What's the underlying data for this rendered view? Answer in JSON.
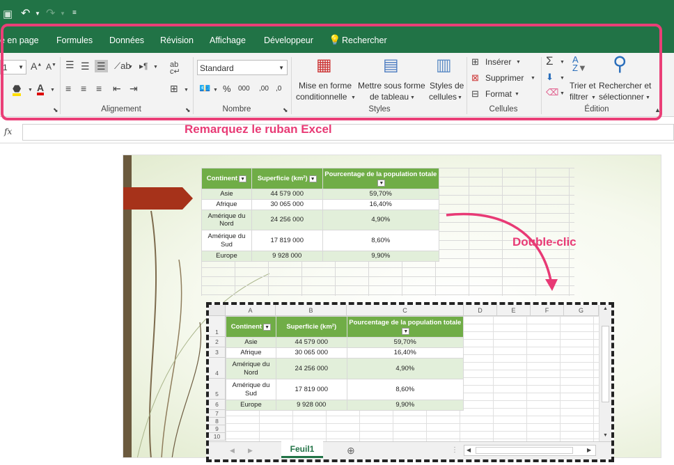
{
  "tabs": [
    "e en page",
    "Formules",
    "Données",
    "Révision",
    "Affichage",
    "Développeur",
    "Rechercher"
  ],
  "font_size_value": "1",
  "number_format": "Standard",
  "ribbon": {
    "conditional_format": [
      "Mise en forme",
      "conditionnelle"
    ],
    "table_format": [
      "Mettre sous forme",
      "de tableau"
    ],
    "cell_styles": [
      "Styles de",
      "cellules"
    ],
    "insert": "Insérer",
    "delete": "Supprimer",
    "format": "Format",
    "sort": [
      "Trier et",
      "filtrer"
    ],
    "find": [
      "Rechercher et",
      "sélectionner"
    ],
    "groups": {
      "alignment": "Alignement",
      "number": "Nombre",
      "styles": "Styles",
      "cells": "Cellules",
      "editing": "Édition"
    },
    "percent": "%",
    "thousands": "000",
    "dec_inc": ",00",
    "fx": "fx"
  },
  "callouts": {
    "ribbon": "Remarquez le ruban Excel",
    "dblclick": "Double-clic"
  },
  "table": {
    "headers": [
      "Continent",
      "Superficie (km²)",
      "Pourcentage de la population totale"
    ],
    "rows": [
      [
        "Asie",
        "44 579 000",
        "59,70%"
      ],
      [
        "Afrique",
        "30 065 000",
        "16,40%"
      ],
      [
        "Amérique du Nord",
        "24 256 000",
        "4,90%"
      ],
      [
        "Amérique du Sud",
        "17 819 000",
        "8,60%"
      ],
      [
        "Europe",
        "9 928 000",
        "9,90%"
      ]
    ]
  },
  "embed": {
    "cols": [
      "A",
      "B",
      "C",
      "D",
      "E",
      "F",
      "G"
    ],
    "rows": [
      "1",
      "2",
      "3",
      "4",
      "5",
      "6",
      "7",
      "8",
      "9",
      "10"
    ],
    "sheet_tab": "Feuil1",
    "header_short": [
      "Continent",
      "Superficie (km²)",
      "Pourcentage de la population totale"
    ]
  },
  "colors": {
    "excel_green": "#217346",
    "table_green": "#70ad47",
    "band": "#e2efda",
    "highlight": "#ea3f77"
  }
}
